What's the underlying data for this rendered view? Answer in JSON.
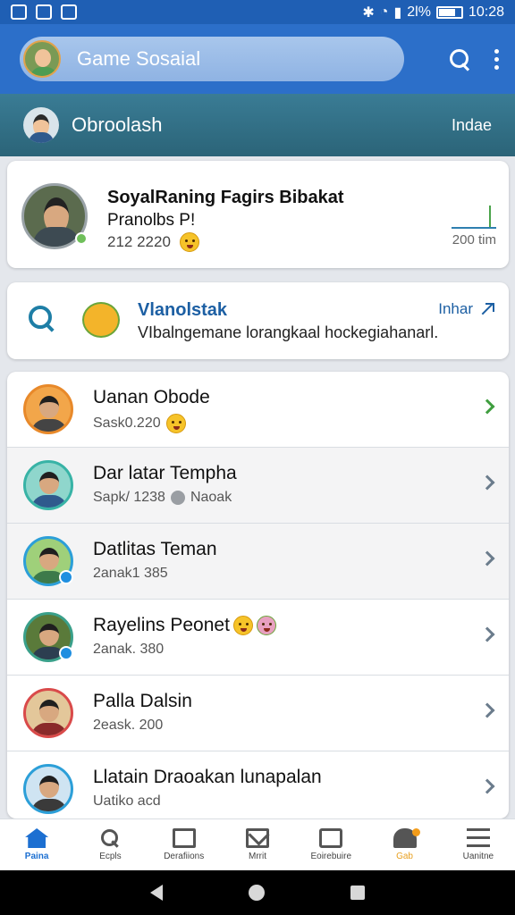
{
  "status_bar": {
    "battery_text": "2l%",
    "time": "10:28"
  },
  "app_bar": {
    "title": "Game Sosaial",
    "icons": [
      "avatar",
      "search-icon",
      "more-vert-icon"
    ]
  },
  "chat_header": {
    "title": "Obroolash",
    "action": "Indae"
  },
  "featured": {
    "title": "SoyalRaning Fagirs Bibakat",
    "subtitle": "Pranolbs P!",
    "meta": "212 2220",
    "time": "200 tim"
  },
  "search_card": {
    "title": "Vlanolstak",
    "subtitle": "VIbalngemane lorangkaal hockegiahanarl.",
    "link": "Inhar"
  },
  "friends": [
    {
      "name": "Uanan Obode",
      "meta": "Sask0.220",
      "extra": "",
      "avatar_color": "#e8892a",
      "chevron_color": "green"
    },
    {
      "name": "Dar latar Tempha",
      "meta": "Sapk/ 1238",
      "extra": "Naoak",
      "avatar_color": "#38b3a6",
      "chevron_color": "grey"
    },
    {
      "name": "Datlitas Teman",
      "meta": "2anak1 385",
      "extra": "",
      "avatar_color": "#2c9fd8",
      "chevron_color": "grey"
    },
    {
      "name": "Rayelins Peonet",
      "meta": "2anak. 380",
      "extra": "",
      "avatar_color": "#3aa08a",
      "chevron_color": "grey"
    },
    {
      "name": "Palla Dalsin",
      "meta": "2eask. 200",
      "extra": "",
      "avatar_color": "#d94a4a",
      "chevron_color": "grey"
    },
    {
      "name": "Llatain Draoakan lunapalan",
      "meta": "Uatiko acd",
      "extra": "",
      "avatar_color": "#2c9fd8",
      "chevron_color": "grey"
    }
  ],
  "bottom_nav": [
    {
      "label": "Paina",
      "icon": "home-icon",
      "active": true
    },
    {
      "label": "Ecpls",
      "icon": "search-icon",
      "active": false
    },
    {
      "label": "Derafiions",
      "icon": "box-icon",
      "active": false
    },
    {
      "label": "Mrrit",
      "icon": "mail-icon",
      "active": false
    },
    {
      "label": "Eoirebuire",
      "icon": "edit-icon",
      "active": false
    },
    {
      "label": "Gab",
      "icon": "bell-icon",
      "active": false
    },
    {
      "label": "Uanitne",
      "icon": "menu-icon",
      "active": false
    }
  ],
  "colors": {
    "primary": "#2c6fc9",
    "header_teal": "#2b6478",
    "accent_green": "#3f9e3f",
    "link_blue": "#1c5fa3"
  }
}
